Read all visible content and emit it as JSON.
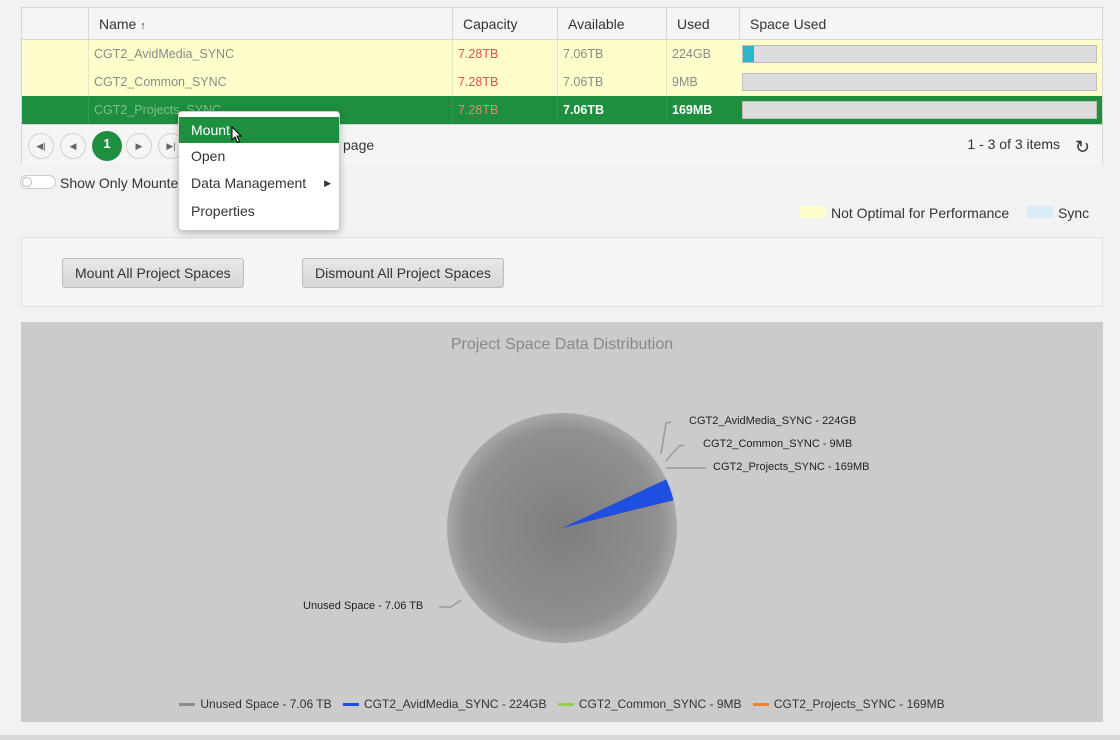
{
  "grid": {
    "columns": [
      "Name",
      "Capacity",
      "Available",
      "Used",
      "Space Used"
    ],
    "sort_indicator": "↑",
    "rows": [
      {
        "name": "CGT2_AvidMedia_SYNC",
        "capacity": "7.28TB",
        "available": "7.06TB",
        "used": "224GB",
        "fill": 0.03,
        "state": "warn"
      },
      {
        "name": "CGT2_Common_SYNC",
        "capacity": "7.28TB",
        "available": "7.06TB",
        "used": "9MB",
        "fill": 0.0,
        "state": "warn"
      },
      {
        "name": "CGT2_Projects_SYNC",
        "capacity": "7.28TB",
        "available": "7.06TB",
        "used": "169MB",
        "fill": 0.0,
        "state": "selected"
      }
    ]
  },
  "pager": {
    "current_page": "1",
    "page_text": "page",
    "items_text": "1 - 3 of 3 items"
  },
  "toggle": {
    "label": "Show Only Mounte"
  },
  "legend_keys": [
    {
      "label": "Not Optimal for Performance",
      "color": "#ffffcc"
    },
    {
      "label": "Sync",
      "color": "#d9ecf7"
    }
  ],
  "buttons": {
    "mount_all": "Mount All Project Spaces",
    "dismount_all": "Dismount All Project Spaces"
  },
  "context_menu": {
    "items": [
      {
        "label": "Mount",
        "highlighted": true
      },
      {
        "label": "Open"
      },
      {
        "label": "Data Management",
        "submenu": true
      },
      {
        "label": "Properties"
      }
    ]
  },
  "chart_data": {
    "type": "pie",
    "title": "Project Space Data Distribution",
    "slices": [
      {
        "label": "Unused Space - 7.06 TB",
        "value": 7060,
        "color": "#8c8c8c"
      },
      {
        "label": "CGT2_AvidMedia_SYNC - 224GB",
        "value": 224,
        "color": "#1f4fe0"
      },
      {
        "label": "CGT2_Common_SYNC - 9MB",
        "value": 0.009,
        "color": "#8fd14f"
      },
      {
        "label": "CGT2_Projects_SYNC - 169MB",
        "value": 0.169,
        "color": "#f08030"
      }
    ],
    "legend": [
      {
        "label": "Unused Space - 7.06 TB",
        "color": "#8c8c8c"
      },
      {
        "label": "CGT2_AvidMedia_SYNC - 224GB",
        "color": "#1f4fe0"
      },
      {
        "label": "CGT2_Common_SYNC - 9MB",
        "color": "#8fd14f"
      },
      {
        "label": "CGT2_Projects_SYNC - 169MB",
        "color": "#f08030"
      }
    ],
    "legend_position": "bottom"
  }
}
